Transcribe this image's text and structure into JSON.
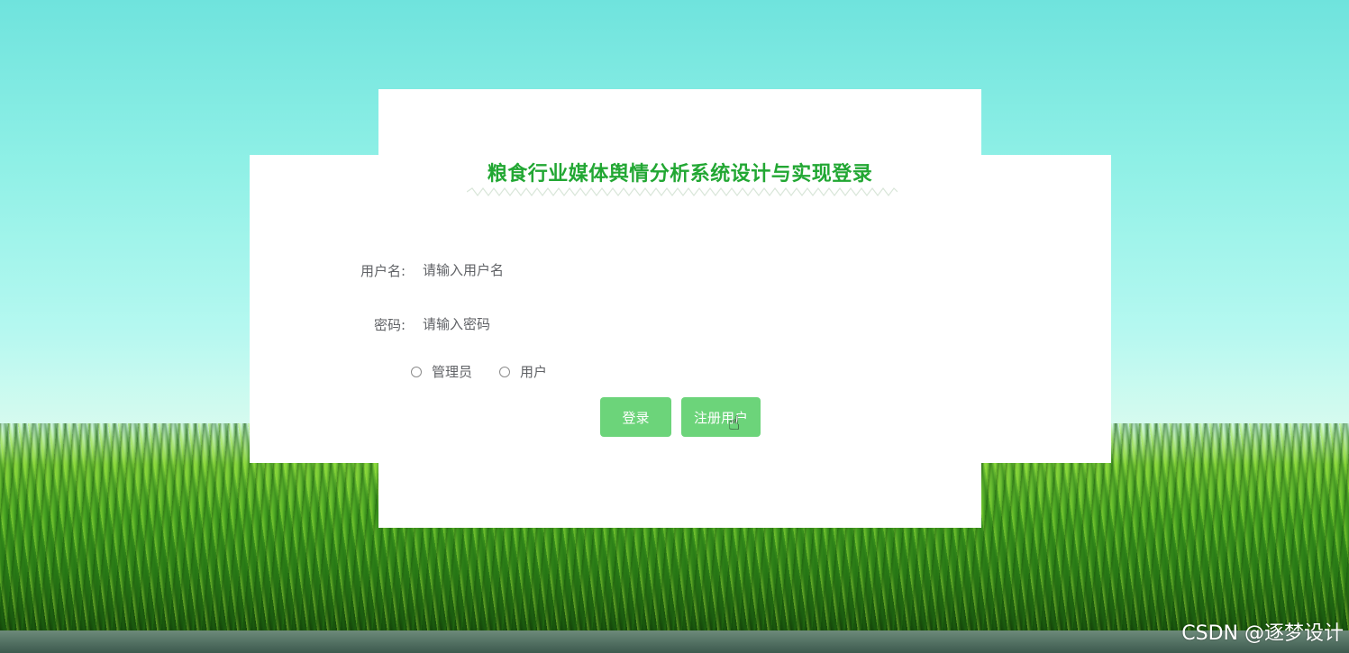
{
  "title": "粮食行业媒体舆情分析系统设计与实现登录",
  "form": {
    "username_label": "用户名:",
    "username_placeholder": "请输入用户名",
    "password_label": "密码:",
    "password_placeholder": "请输入密码",
    "roles": [
      "管理员",
      "用户"
    ]
  },
  "buttons": {
    "login": "登录",
    "register": "注册用户"
  },
  "watermark": "CSDN @逐梦设计",
  "colors": {
    "title": "#22a733",
    "button": "#6cd47a",
    "sky": "#6fe3dd"
  }
}
